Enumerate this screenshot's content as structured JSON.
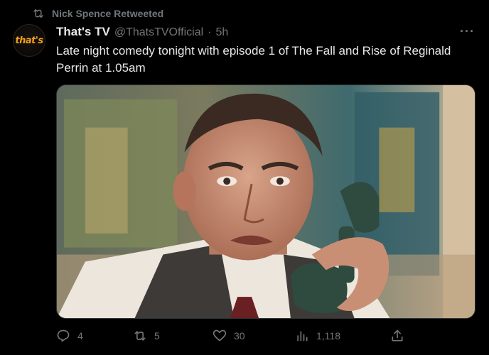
{
  "retweet": {
    "text": "Nick Spence Retweeted",
    "icon": "retweet-icon"
  },
  "author": {
    "avatar_text": "that's",
    "display_name": "That's TV",
    "handle": "@ThatsTVOfficial",
    "separator": "·",
    "time": "5h"
  },
  "more_label": "···",
  "tweet": {
    "text": "Late night comedy tonight with episode 1 of The Fall and Rise of Reginald Perrin at 1.05am"
  },
  "media": {
    "description_icon": "photo-image"
  },
  "actions": {
    "replies": "4",
    "retweets": "5",
    "likes": "30",
    "views": "1,118"
  },
  "colors": {
    "background": "#000000",
    "text": "#e7e9ea",
    "muted": "#71767b",
    "brand_orange": "#f0a21c"
  }
}
